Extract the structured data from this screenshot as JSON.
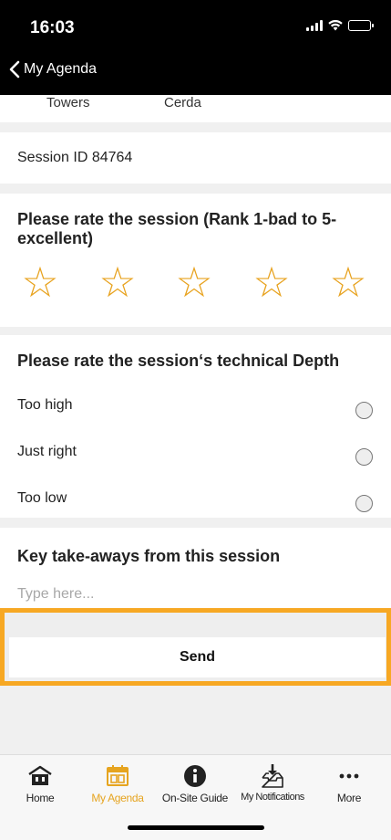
{
  "status_bar": {
    "time": "16:03"
  },
  "nav": {
    "back_label": "My Agenda"
  },
  "room_strip": {
    "col1": "Towers",
    "col2": "Cerda"
  },
  "session": {
    "id_text": "Session ID 84764"
  },
  "rating": {
    "question": "Please rate the session (Rank 1-bad to 5-excellent)",
    "star_count": 5,
    "selected": 0,
    "star_color": "#e8a320"
  },
  "depth": {
    "question": "Please rate the session‘s technical Depth",
    "options": [
      "Too high",
      "Just right",
      "Too low"
    ]
  },
  "takeaways": {
    "question": "Key take-aways from this session",
    "placeholder": "Type here..."
  },
  "send": {
    "label": "Send",
    "highlight_color": "#f7a823"
  },
  "tabbar": {
    "tabs": [
      {
        "label": "Home",
        "icon": "home-icon"
      },
      {
        "label": "My Agenda",
        "icon": "calendar-icon",
        "active": true
      },
      {
        "label": "On-Site Guide",
        "icon": "info-icon"
      },
      {
        "label": "My Notifications",
        "icon": "inbox-icon"
      },
      {
        "label": "More",
        "icon": "more-dots-icon"
      }
    ],
    "active_color": "#e6a41f"
  }
}
